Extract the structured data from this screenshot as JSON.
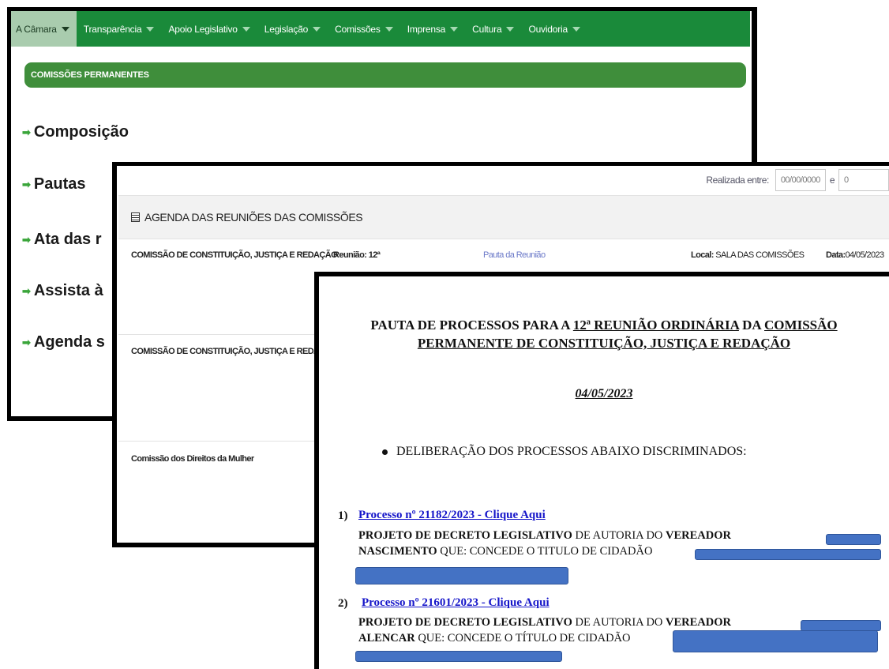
{
  "nav": {
    "items": [
      "A Câmara",
      "Transparência",
      "Apoio Legislativo",
      "Legislação",
      "Comissões",
      "Imprensa",
      "Cultura",
      "Ouvidoria"
    ],
    "active_index": 0
  },
  "section": {
    "title": "COMISSÕES PERMANENTES"
  },
  "menu": {
    "links": [
      "Composição",
      "Pautas",
      "Ata das r",
      "Assista à",
      "Agenda s"
    ]
  },
  "filter": {
    "label": "Realizada entre:",
    "date_from": "00/00/0000",
    "separator": "e",
    "date_to": "0"
  },
  "agenda": {
    "title": "AGENDA DAS REUNIÕES DAS COMISSÕES",
    "rows": [
      {
        "commission": "COMISSÃO DE CONSTITUIÇÃO, JUSTIÇA E REDAÇÃO",
        "meeting": "Reunião: 12ª",
        "link": "Pauta da Reunião",
        "local_label": "Local:",
        "local_value": "SALA DAS COMISSÕES",
        "date_label": "Data:",
        "date_value": "04/05/2023"
      },
      {
        "commission": "COMISSÃO DE CONSTITUIÇÃO, JUSTIÇA E REDAÇÃO"
      },
      {
        "commission": "Comissão dos Direitos da Mulher"
      }
    ]
  },
  "document": {
    "title_pre": "PAUTA DE PROCESSOS PARA A ",
    "title_u1": "12ª REUNIÃO ORDINÁRIA",
    "title_mid": " DA ",
    "title_u2": "COMISSÃO",
    "title_line2": "PERMANENTE DE CONSTITUIÇÃO, JUSTIÇA E REDAÇÃO",
    "date": "04/05/2023",
    "bullet": "DELIBERAÇÃO DOS PROCESSOS ABAIXO DISCRIMINADOS:",
    "processes": [
      {
        "num": "1)",
        "link": "Processo nº 21182/2023 - Clique Aqui",
        "l1_b1": "PROJETO DE DECRETO LEGISLATIVO",
        "l1_t": " DE AUTORIA DO ",
        "l1_b2": "VEREADOR",
        "l2_b": "NASCIMENTO",
        "l2_t": " QUE: CONCEDE O TITULO DE CIDADÃO"
      },
      {
        "num": "2)",
        "link": "Processo nº 21601/2023 - Clique Aqui",
        "l1_b1": "PROJETO DE DECRETO LEGISLATIVO",
        "l1_t": " DE AUTORIA DO ",
        "l1_b2": "VEREADOR",
        "l2_b": "ALENCAR",
        "l2_t": " QUE: CONCEDE O TÍTULO DE CIDADÃO"
      }
    ]
  },
  "colors": {
    "nav_green": "#1a8a3a",
    "band_green": "#3f8e3b",
    "redaction": "#4472c4",
    "hyperlink": "#1515c9"
  }
}
